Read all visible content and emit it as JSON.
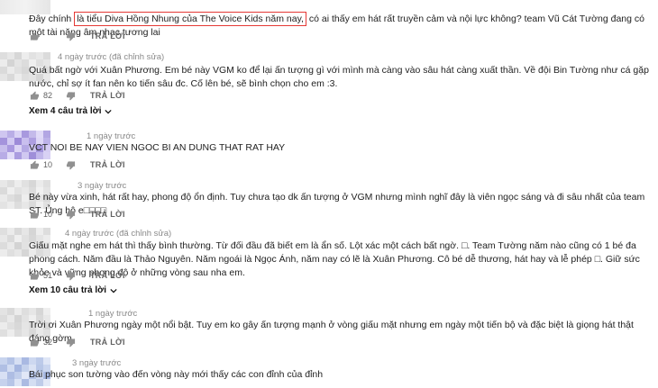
{
  "comments": [
    {
      "text_before": "Đây chính ",
      "text_highlight": "là tiểu Diva Hồng Nhung của The Voice Kids năm nay,",
      "text_after": " có ai thấy em hát rất truyền cảm và nội lực không? team Vũ Cát Tường đang có một tài năng âm nhạc tương lai",
      "likes": "",
      "reply_label": "TRẢ LỜI"
    },
    {
      "meta": "4 ngày trước (đã chỉnh sửa)",
      "text": "Quá bất ngờ với Xuân Phương. Em bé này VGM ko để lại ấn tượng gì với mình mà càng vào sâu hát càng xuất thần. Về đội Bin Tường như cá gặp nước, chỉ sợ ít fan nên ko tiến sâu đc. Cố lên bé, sẽ bình chọn cho em :3.",
      "likes": "82",
      "reply_label": "TRẢ LỜI",
      "replies_label": "Xem 4 câu trả lời"
    },
    {
      "meta": "1 ngày trước",
      "text": "VCT  NOI  BE  NAY  VIEN  NGOC  BI  AN    DUNG  THAT  RAT  HAY",
      "likes": "10",
      "reply_label": "TRẢ LỜI"
    },
    {
      "meta": "3 ngày trước",
      "text": "Bé này vừa xinh, hát rất hay, phong độ ổn định. Tuy chưa tạo dk ấn tượng ở VGM nhưng mình nghĩ đây là viên ngọc sáng và đi sâu nhất của team ST. Ủng hộ e□□□□",
      "likes": "10",
      "reply_label": "TRẢ LỜI"
    },
    {
      "meta": "4 ngày trước (đã chỉnh sửa)",
      "text": "Giấu mặt nghe em hát thì thấy bình thường. Từ đối đầu đã biết em là ẩn số. Lột xác một cách bất ngờ. □. Team Tường năm nào cũng có 1 bé đa phong cách. Năm đầu là Thảo Nguyên. Năm ngoái là Ngọc Ánh, năm nay có lẽ là Xuân Phương. Cô bé dễ thương, hát hay và lễ phép □. Giữ sức khỏe và vững phong độ ở những vòng sau nha em.",
      "likes": "51",
      "reply_label": "TRẢ LỜI",
      "replies_label": "Xem 10 câu trả lời"
    },
    {
      "meta": "1 ngày trước",
      "text": "Trời ơi Xuân Phương ngày một nổi bật. Tuy em ko gây ấn tượng mạnh ở vòng giấu mặt nhưng em ngày một tiến bộ và đặc biệt là giọng hát thật đáng gờm",
      "likes": "32",
      "reply_label": "TRẢ LỜI"
    },
    {
      "meta": "3 ngày trước",
      "text": "Bái phục son tường vào đến vòng này mới thấy các con đỉnh của đỉnh",
      "likes": "",
      "reply_label": ""
    }
  ],
  "colors": {
    "highlight_border": "#e53935",
    "meta_text": "#8a8a8a",
    "action_text": "#606060"
  },
  "icons": {
    "like": "thumbs-up-icon",
    "dislike": "thumbs-down-icon",
    "expand": "chevron-down-icon"
  }
}
